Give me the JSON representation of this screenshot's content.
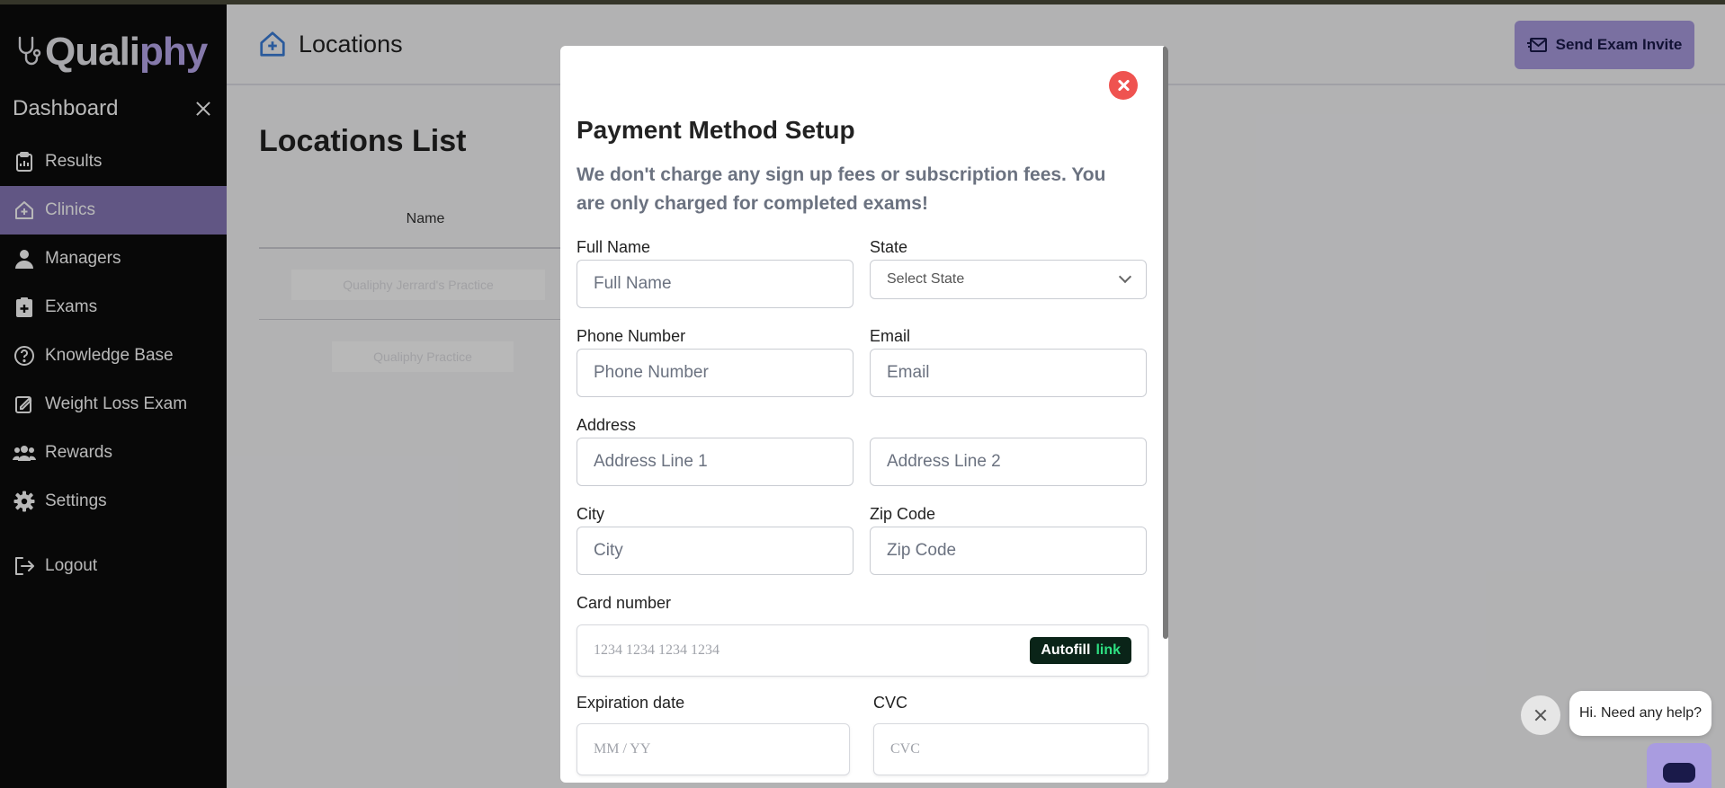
{
  "app": {
    "logo_main": "Quali",
    "logo_accent": "phy",
    "logo_tail": ""
  },
  "sidebar": {
    "title": "Dashboard",
    "items": [
      {
        "label": "Results",
        "icon": "clipboard-icon",
        "active": false
      },
      {
        "label": "Clinics",
        "icon": "home-plus-icon",
        "active": true
      },
      {
        "label": "Managers",
        "icon": "user-icon",
        "active": false
      },
      {
        "label": "Exams",
        "icon": "clipboard-plus-icon",
        "active": false
      },
      {
        "label": "Knowledge Base",
        "icon": "question-circle-icon",
        "active": false
      },
      {
        "label": "Weight Loss Exam",
        "icon": "edit-square-icon",
        "active": false
      },
      {
        "label": "Rewards",
        "icon": "users-icon",
        "active": false
      },
      {
        "label": "Settings",
        "icon": "gear-icon",
        "active": false
      }
    ],
    "logout": "Logout"
  },
  "header": {
    "title": "Locations",
    "send_button": "Send Exam Invite"
  },
  "locations": {
    "title": "Locations List",
    "column_name": "Name",
    "rows": [
      "Qualiphy Jerrard's Practice",
      "Qualiphy Practice"
    ]
  },
  "modal": {
    "title": "Payment Method Setup",
    "description": "We don't charge any sign up fees or subscription fees. You are only charged for completed exams!",
    "full_name_label": "Full Name",
    "full_name_placeholder": "Full Name",
    "state_label": "State",
    "state_value": "Select State",
    "phone_label": "Phone Number",
    "phone_placeholder": "Phone Number",
    "email_label": "Email",
    "email_placeholder": "Email",
    "address_label": "Address",
    "address1_placeholder": "Address Line 1",
    "address2_placeholder": "Address Line 2",
    "city_label": "City",
    "city_placeholder": "City",
    "zip_label": "Zip Code",
    "zip_placeholder": "Zip Code",
    "card_label": "Card number",
    "card_placeholder": "1234 1234 1234 1234",
    "autofill_label": "Autofill",
    "autofill_link": "link",
    "exp_label": "Expiration date",
    "exp_placeholder": "MM / YY",
    "cvc_label": "CVC",
    "cvc_placeholder": "CVC"
  },
  "chat": {
    "bubble_text": "Hi. Need any help?"
  },
  "colors": {
    "accent": "#a99ce0",
    "sidebar_active": "#8778b8",
    "sidebar_bg": "#0c0c0c",
    "close_red": "#ef5350",
    "link_green": "#2ee081"
  }
}
